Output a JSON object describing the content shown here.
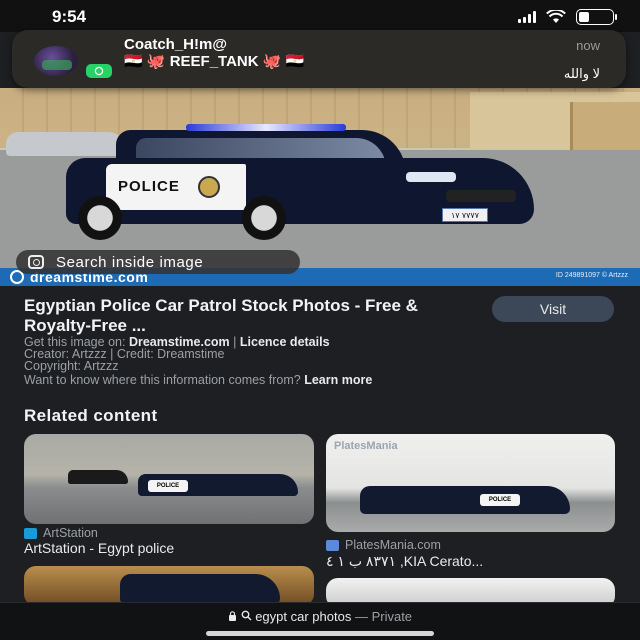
{
  "status_bar": {
    "time": "9:54"
  },
  "notification": {
    "title": "Coatch_H!m@",
    "subtitle": "🇪🇬 🐙 REEF_TANK 🐙 🇪🇬",
    "time": "now",
    "body": "لا والله",
    "app": "whatsapp"
  },
  "hero": {
    "search_inside_label": "Search inside image",
    "watermark_logo": "dreamstime.com",
    "watermark_id": "ID 249891097 © Artzzz",
    "car_label": "POLICE",
    "plate": "٧٧٧٧ ١٧"
  },
  "result": {
    "title": "Egyptian Police Car Patrol Stock Photos - Free & Royalty-Free ...",
    "visit_label": "Visit",
    "get_prefix": "Get this image on:",
    "get_site": "Dreamstime.com",
    "separator": "|",
    "licence": "Licence details",
    "creator_line": "Creator: Artzzz | Credit: Dreamstime",
    "copyright_line": "Copyright: Artzzz",
    "info_question": "Want to know where this information comes from?",
    "learn_more": "Learn more"
  },
  "related": {
    "heading": "Related content",
    "items": [
      {
        "source": "ArtStation",
        "title": "ArtStation - Egypt police",
        "source_color": "#1a9bd7"
      },
      {
        "source": "PlatesMania.com",
        "title": "٨٣٧١ ب ١ ٤ ,KIA Cerato...",
        "source_color": "#5a8ad8",
        "badge": "PlatesMania"
      }
    ]
  },
  "bottom_bar": {
    "url": "egypt car photos",
    "dash": "—",
    "mode": "Private"
  }
}
